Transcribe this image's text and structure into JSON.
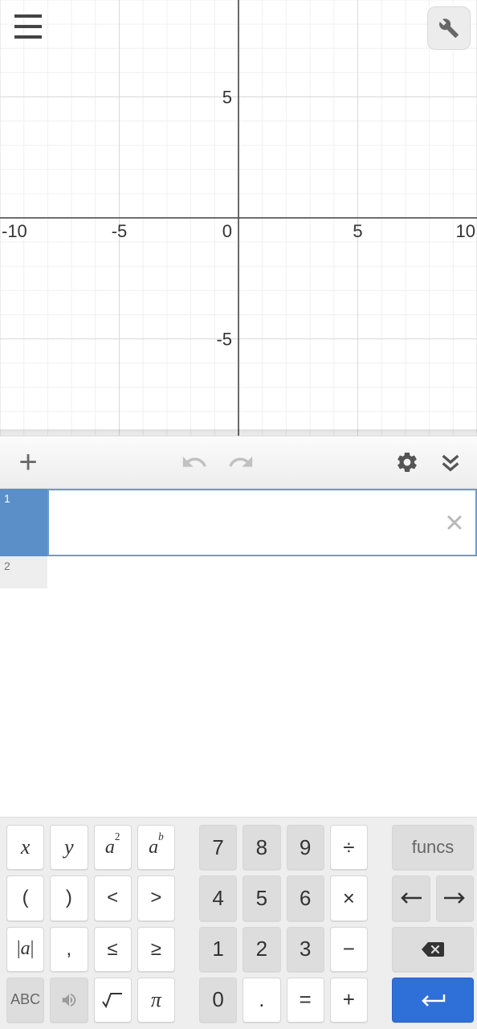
{
  "chart_data": {
    "type": "scatter",
    "series": [],
    "xlabel": "",
    "ylabel": "",
    "xlim": [
      -10,
      10
    ],
    "ylim": [
      -9,
      9
    ],
    "x_ticks": [
      {
        "v": -10,
        "label": "-10"
      },
      {
        "v": -5,
        "label": "-5"
      },
      {
        "v": 0,
        "label": "0"
      },
      {
        "v": 5,
        "label": "5"
      },
      {
        "v": 10,
        "label": "10"
      }
    ],
    "y_ticks": [
      {
        "v": -5,
        "label": "-5"
      },
      {
        "v": 5,
        "label": "5"
      }
    ],
    "minor_grid_step": 1,
    "major_grid_step": 5
  },
  "toolbar": {
    "plus": "+"
  },
  "expressions": {
    "rows": [
      {
        "index": "1",
        "value": ""
      },
      {
        "index": "2",
        "value": ""
      }
    ]
  },
  "keyboard": {
    "left": {
      "r1": [
        "x",
        "y",
        "a²",
        "aᵇ"
      ],
      "r2": [
        "(",
        ")",
        "<",
        ">"
      ],
      "r3": [
        "|a|",
        ",",
        "≤",
        "≥"
      ],
      "r4": [
        "ABC",
        "sound",
        "√",
        "π"
      ]
    },
    "mid": {
      "r1": [
        "7",
        "8",
        "9",
        "÷"
      ],
      "r2": [
        "4",
        "5",
        "6",
        "×"
      ],
      "r3": [
        "1",
        "2",
        "3",
        "−"
      ],
      "r4": [
        "0",
        ".",
        "=",
        "+"
      ]
    },
    "right": {
      "funcs": "funcs"
    }
  }
}
